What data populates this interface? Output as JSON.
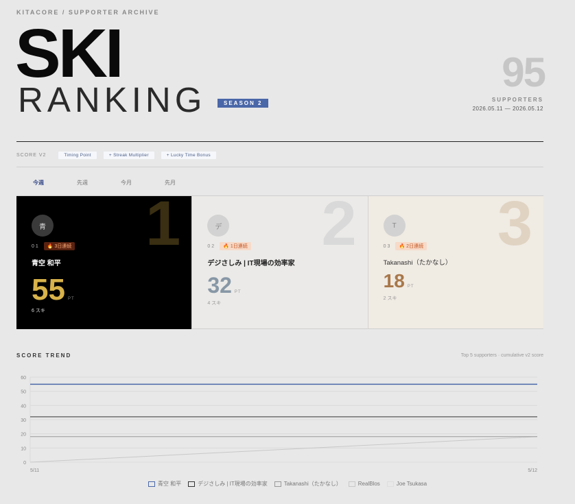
{
  "header": {
    "eyebrow": "KITACORE / SUPPORTER ARCHIVE",
    "title_main": "SKI",
    "title_sub": "RANKING",
    "season": "SEASON 2",
    "supporters_count": "95",
    "supporters_label": "SUPPORTERS",
    "date_range": "2026.05.11 — 2026.05.12"
  },
  "score": {
    "label": "SCORE V2",
    "chips": [
      "Timing Point",
      "+ Streak Multiplier",
      "+ Lucky Time Bonus"
    ]
  },
  "tabs": [
    {
      "label": "今週",
      "active": true
    },
    {
      "label": "先週",
      "active": false
    },
    {
      "label": "今月",
      "active": false
    },
    {
      "label": "先月",
      "active": false
    }
  ],
  "cards": [
    {
      "rank_big": "1",
      "avatar": "青",
      "rank_no": "01",
      "streak": "3日連続",
      "name": "青空 和平",
      "points": "55",
      "unit": "PT",
      "skis": "6 スキ"
    },
    {
      "rank_big": "2",
      "avatar": "デ",
      "rank_no": "02",
      "streak": "1日連続",
      "name": "デジさしみ | IT現場の効率家",
      "points": "32",
      "unit": "PT",
      "skis": "4 スキ"
    },
    {
      "rank_big": "3",
      "avatar": "T",
      "rank_no": "03",
      "streak": "2日連続",
      "name": "Takanashi（たかなし）",
      "points": "18",
      "unit": "PT",
      "skis": "2 スキ"
    }
  ],
  "trend": {
    "title": "SCORE TREND",
    "subtitle": "Top 5 supporters · cumulative v2 score"
  },
  "chart_data": {
    "type": "line",
    "x": [
      "5/11",
      "5/12"
    ],
    "ylim": [
      0,
      60
    ],
    "yticks": [
      0,
      10,
      20,
      30,
      40,
      50,
      60
    ],
    "grid": true,
    "legend_position": "bottom",
    "series": [
      {
        "name": "青空 和平",
        "values": [
          55,
          55
        ],
        "color": "#4a67a8"
      },
      {
        "name": "デジさしみ | IT現場の効率家",
        "values": [
          32,
          32
        ],
        "color": "#333333"
      },
      {
        "name": "Takanashi（たかなし）",
        "values": [
          18,
          18
        ],
        "color": "#999999"
      },
      {
        "name": "RealBlos",
        "values": [
          0,
          18
        ],
        "color": "#c8c8c8"
      },
      {
        "name": "Joe Tsukasa",
        "values": [
          0,
          0
        ],
        "color": "#dddddd"
      }
    ]
  }
}
